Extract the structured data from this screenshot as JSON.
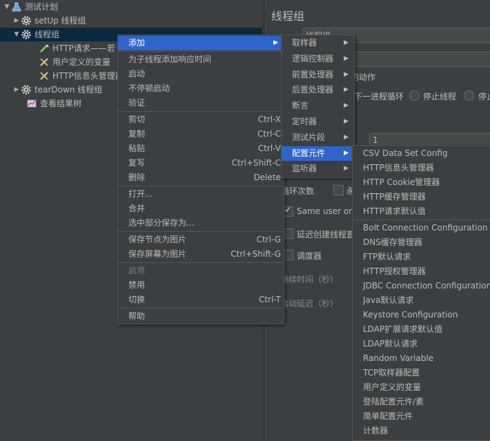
{
  "tree": {
    "test_plan": "测试计划",
    "setup_group": "setUp 线程组",
    "thread_group": "线程组",
    "http_request": "HTTP请求——若",
    "user_vars": "用户定义的变量",
    "http_header": "HTTP信息头管理器",
    "teardown_group": "tearDown 线程组",
    "result_tree": "查看结果树"
  },
  "panel": {
    "title": "线程组",
    "name_value": "线程组",
    "action_label": "行的动作",
    "radio_continue": "下一进程循环",
    "radio_stop_thread": "停止线程",
    "radio_stop_test": "停止",
    "thread_count_value": "1",
    "loop_label": "循环次数",
    "forever_label": "永",
    "same_user_label": "Same user on e",
    "delay_create_label": "延迟创建线程直",
    "scheduler_label": "调度器",
    "duration_label": "持续时间（秒）",
    "startup_delay_label": "启动延迟（秒）"
  },
  "context_menu": [
    {
      "label": "添加",
      "submenu": true,
      "highlighted": true
    },
    {
      "sep": true
    },
    {
      "label": "为子线程添加响应时间"
    },
    {
      "label": "启动"
    },
    {
      "label": "不停顿启动"
    },
    {
      "label": "验证"
    },
    {
      "sep": true
    },
    {
      "label": "剪切",
      "shortcut": "Ctrl-X"
    },
    {
      "label": "复制",
      "shortcut": "Ctrl-C"
    },
    {
      "label": "粘贴",
      "shortcut": "Ctrl-V"
    },
    {
      "label": "复写",
      "shortcut": "Ctrl+Shift-C"
    },
    {
      "label": "删除",
      "shortcut": "Delete"
    },
    {
      "sep": true
    },
    {
      "label": "打开..."
    },
    {
      "label": "合并"
    },
    {
      "label": "选中部分保存为..."
    },
    {
      "sep": true
    },
    {
      "label": "保存节点为图片",
      "shortcut": "Ctrl-G"
    },
    {
      "label": "保存屏幕为图片",
      "shortcut": "Ctrl+Shift-G"
    },
    {
      "sep": true
    },
    {
      "label": "启用",
      "disabled": true
    },
    {
      "label": "禁用"
    },
    {
      "label": "切换",
      "shortcut": "Ctrl-T"
    },
    {
      "sep": true
    },
    {
      "label": "帮助"
    }
  ],
  "add_submenu": [
    {
      "label": "取样器",
      "submenu": true
    },
    {
      "label": "逻辑控制器",
      "submenu": true
    },
    {
      "label": "前置处理器",
      "submenu": true
    },
    {
      "label": "后置处理器",
      "submenu": true
    },
    {
      "label": "断言",
      "submenu": true
    },
    {
      "label": "定时器",
      "submenu": true
    },
    {
      "label": "测试片段",
      "submenu": true
    },
    {
      "label": "配置元件",
      "submenu": true,
      "highlighted": true
    },
    {
      "label": "监听器",
      "submenu": true
    }
  ],
  "config_submenu": [
    {
      "label": "CSV Data Set Config"
    },
    {
      "label": "HTTP信息头管理器"
    },
    {
      "label": "HTTP Cookie管理器"
    },
    {
      "label": "HTTP缓存管理器"
    },
    {
      "label": "HTTP请求默认值"
    },
    {
      "sep": true
    },
    {
      "label": "Bolt Connection Configuration"
    },
    {
      "label": "DNS缓存管理器"
    },
    {
      "label": "FTP默认请求"
    },
    {
      "label": "HTTP授权管理器"
    },
    {
      "label": "JDBC Connection Configuration"
    },
    {
      "label": "Java默认请求"
    },
    {
      "label": "Keystore Configuration"
    },
    {
      "label": "LDAP扩展请求默认值"
    },
    {
      "label": "LDAP默认请求"
    },
    {
      "label": "Random Variable"
    },
    {
      "label": "TCP取样器配置"
    },
    {
      "label": "用户定义的变量"
    },
    {
      "label": "登陆配置元件/素"
    },
    {
      "label": "简单配置元件"
    },
    {
      "label": "计数器"
    }
  ],
  "colors": {
    "background": "#3c3f41",
    "highlight": "#2f65ca",
    "tree_selected": "#0d293e",
    "text": "#bbbbbb"
  }
}
